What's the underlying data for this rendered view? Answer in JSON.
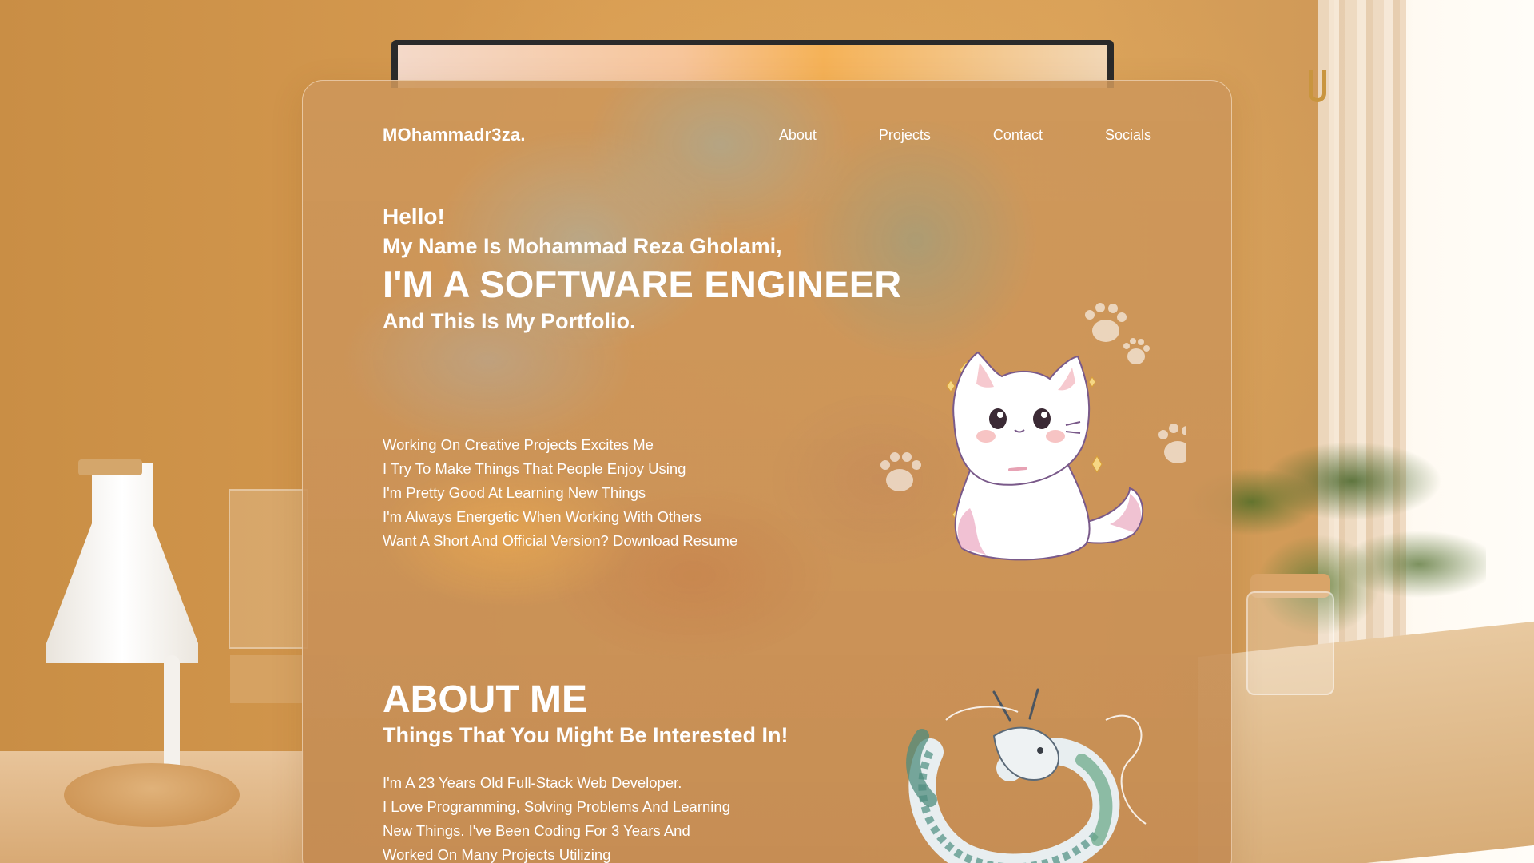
{
  "site": {
    "brand": "MOhammadr3za."
  },
  "nav": {
    "items": [
      {
        "label": "About"
      },
      {
        "label": "Projects"
      },
      {
        "label": "Contact"
      },
      {
        "label": "Socials"
      }
    ]
  },
  "hero": {
    "hello": "Hello!",
    "name_line": "My Name Is Mohammad Reza Gholami,",
    "headline": "I'M A SOFTWARE ENGINEER",
    "subline": "And This Is My Portfolio."
  },
  "traits": {
    "lines": [
      "Working On Creative Projects Excites Me",
      "I Try To Make Things That People Enjoy Using",
      "I'm Pretty Good At Learning New Things",
      "I'm Always Energetic When Working With Others"
    ],
    "resume_prompt": "Want A Short And Official Version?",
    "resume_link": "Download Resume"
  },
  "about": {
    "title": "ABOUT ME",
    "subtitle": "Things That You Might Be Interested In!",
    "lines": [
      "I'm A 23 Years Old Full-Stack Web Developer.",
      "I Love Programming, Solving Problems And Learning",
      "New Things. I've Been Coding For 3 Years And",
      "Worked On Many Projects Utilizing"
    ]
  },
  "colors": {
    "text": "#ffffff",
    "card_tint": "#cc955a",
    "wall": "#d29a52"
  },
  "icons": {
    "cat": "cat-illustration",
    "paw": "paw-print-icon",
    "sparkle": "sparkle-icon",
    "dragon": "dragon-illustration"
  }
}
